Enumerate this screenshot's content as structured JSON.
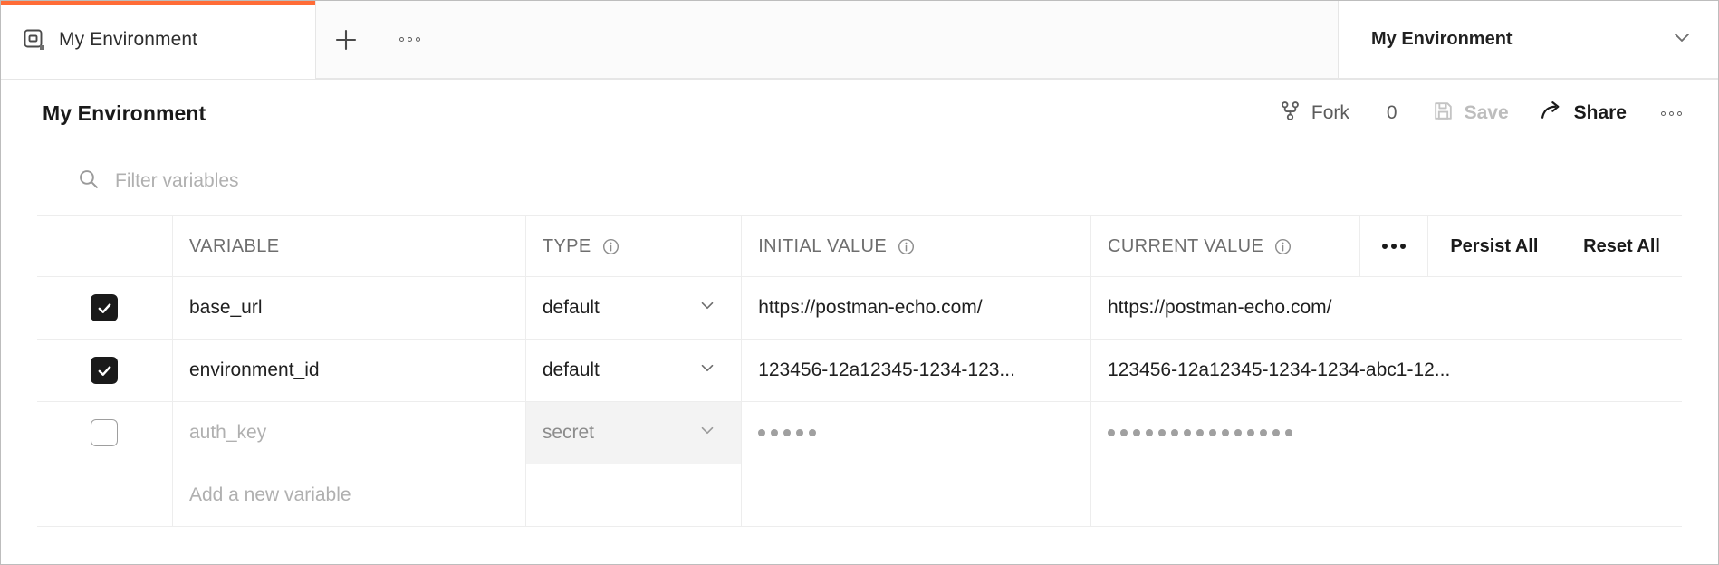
{
  "window": {
    "accent_color": "#ff6c37",
    "border_color": "#bdbdbd"
  },
  "tabbar": {
    "tab_label": "My Environment",
    "tab_icon": "environment-icon",
    "new_tab_icon": "plus-icon",
    "tab_menu_icon": "more-horizontal-icon",
    "env_selector_label": "My Environment",
    "env_selector_icon": "chevron-down-icon"
  },
  "toolbar": {
    "title": "My Environment",
    "fork_label": "Fork",
    "fork_icon": "fork-icon",
    "fork_count": "0",
    "save_label": "Save",
    "save_icon": "save-icon",
    "save_disabled": true,
    "share_label": "Share",
    "share_icon": "share-icon",
    "more_icon": "more-horizontal-icon"
  },
  "filter": {
    "icon": "search-icon",
    "placeholder": "Filter variables",
    "value": ""
  },
  "table": {
    "headers": {
      "variable": "VARIABLE",
      "type": "TYPE",
      "initial_value": "INITIAL VALUE",
      "current_value": "CURRENT VALUE",
      "more_icon": "more-horizontal-icon",
      "persist_all": "Persist All",
      "reset_all": "Reset All",
      "info_icon": "info-circle-icon"
    },
    "rows": [
      {
        "checked": true,
        "variable": "base_url",
        "type": "default",
        "type_dropdown_icon": "chevron-down-icon",
        "initial_value": "https://postman-echo.com/",
        "current_value": "https://postman-echo.com/",
        "masked": false,
        "disabled": false,
        "type_hovered": false
      },
      {
        "checked": true,
        "variable": "environment_id",
        "type": "default",
        "type_dropdown_icon": "chevron-down-icon",
        "initial_value": "123456-12a12345-1234-123...",
        "current_value": "123456-12a12345-1234-1234-abc1-12...",
        "masked": false,
        "disabled": false,
        "type_hovered": false
      },
      {
        "checked": false,
        "variable": "auth_key",
        "type": "secret",
        "type_dropdown_icon": "chevron-down-icon",
        "initial_value": "",
        "current_value": "",
        "masked": true,
        "initial_mask_dots": 5,
        "current_mask_dots": 15,
        "disabled": true,
        "type_hovered": true
      }
    ],
    "add_row_placeholder": "Add a new variable"
  }
}
